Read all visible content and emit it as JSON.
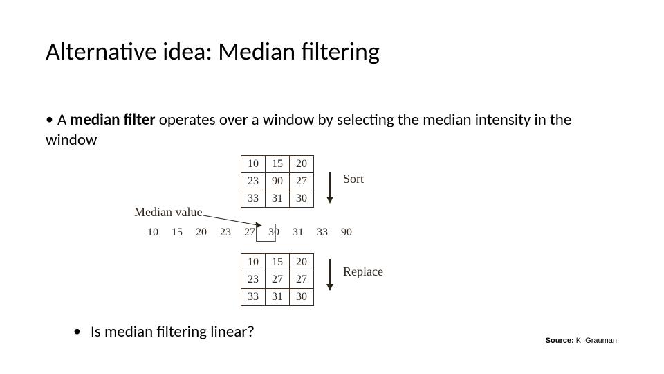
{
  "title": "Alternative idea: Median filtering",
  "bullet1": {
    "prefix": "A ",
    "bold": "median filter",
    "rest": " operates over a window by selecting the median intensity in the window"
  },
  "figure": {
    "grid_top": [
      [
        "10",
        "15",
        "20"
      ],
      [
        "23",
        "90",
        "27"
      ],
      [
        "33",
        "31",
        "30"
      ]
    ],
    "grid_bottom": [
      [
        "10",
        "15",
        "20"
      ],
      [
        "23",
        "27",
        "27"
      ],
      [
        "33",
        "31",
        "30"
      ]
    ],
    "sort_label": "Sort",
    "replace_label": "Replace",
    "median_label": "Median value",
    "sorted": [
      "10",
      "15",
      "20",
      "23",
      "27",
      "30",
      "31",
      "33",
      "90"
    ],
    "median_value": "27"
  },
  "bullet2": "Is median filtering linear?",
  "source": {
    "label": "Source:",
    "author": " K. Grauman"
  }
}
